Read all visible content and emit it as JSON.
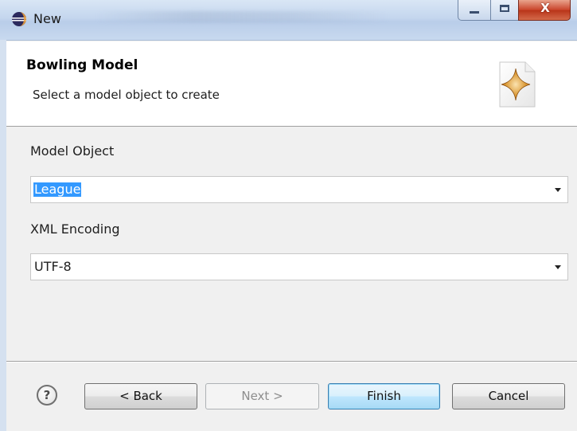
{
  "window": {
    "title": "New",
    "app_icon": "eclipse-icon",
    "controls": {
      "minimize": "minimize-icon",
      "maximize": "maximize-icon",
      "close_label": "X"
    }
  },
  "header": {
    "title": "Bowling Model",
    "subtitle": "Select a model object to create",
    "banner_icon": "wizard-sparkle-icon"
  },
  "form": {
    "model_object": {
      "label": "Model Object",
      "value": "League"
    },
    "xml_encoding": {
      "label": "XML Encoding",
      "value": "UTF-8"
    }
  },
  "buttons": {
    "help": "?",
    "back": "< Back",
    "next": "Next >",
    "finish": "Finish",
    "cancel": "Cancel"
  },
  "colors": {
    "selection": "#3399ff",
    "default_button_border": "#3c7fb1",
    "close_button": "#c9442a"
  }
}
